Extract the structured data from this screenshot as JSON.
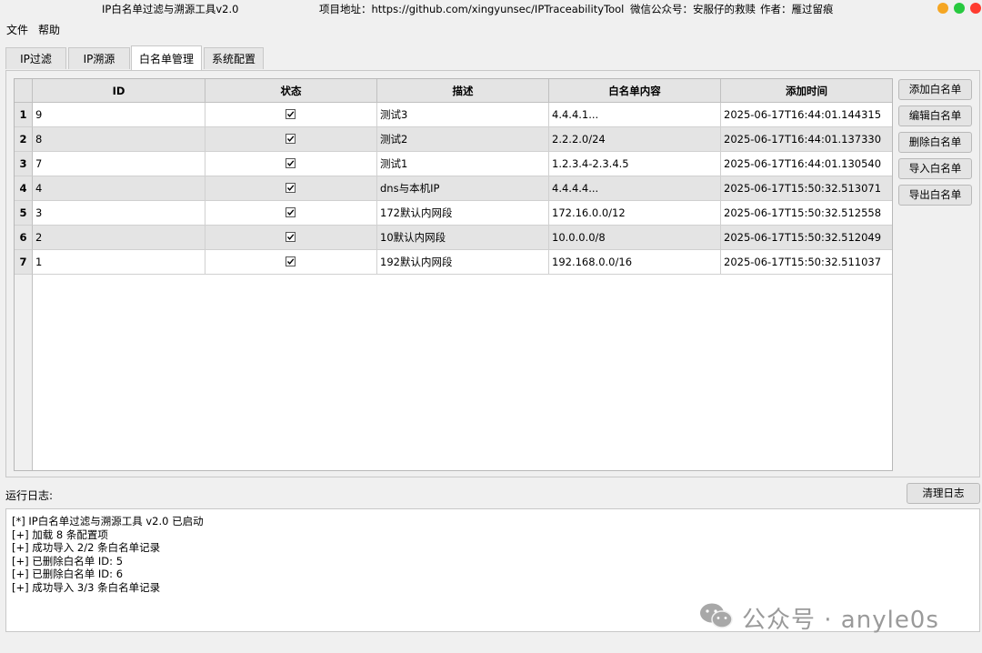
{
  "window": {
    "title": "IP白名单过滤与溯源工具v2.0",
    "project_url_label": "项目地址：https://github.com/xingyunsec/IPTraceabilityTool",
    "wechat_label": "微信公众号：安服仔的救赎",
    "author_label": "作者：雁过留痕",
    "traffic_colors": [
      "#f5a623",
      "#27c93f",
      "#ff3b30"
    ]
  },
  "menu": [
    "文件",
    "帮助"
  ],
  "tabs": [
    "IP过滤",
    "IP溯源",
    "白名单管理",
    "系统配置"
  ],
  "active_tab": "白名单管理",
  "table": {
    "headers": [
      "ID",
      "状态",
      "描述",
      "白名单内容",
      "添加时间"
    ],
    "rows": [
      {
        "num": "1",
        "id": "9",
        "checked": true,
        "desc": "测试3",
        "content": "4.4.4.1...",
        "time": "2025-06-17T16:44:01.144315"
      },
      {
        "num": "2",
        "id": "8",
        "checked": true,
        "desc": "测试2",
        "content": "2.2.2.0/24",
        "time": "2025-06-17T16:44:01.137330"
      },
      {
        "num": "3",
        "id": "7",
        "checked": true,
        "desc": "测试1",
        "content": "1.2.3.4-2.3.4.5",
        "time": "2025-06-17T16:44:01.130540"
      },
      {
        "num": "4",
        "id": "4",
        "checked": true,
        "desc": "dns与本机IP",
        "content": "4.4.4.4...",
        "time": "2025-06-17T15:50:32.513071"
      },
      {
        "num": "5",
        "id": "3",
        "checked": true,
        "desc": "172默认内网段",
        "content": "172.16.0.0/12",
        "time": "2025-06-17T15:50:32.512558"
      },
      {
        "num": "6",
        "id": "2",
        "checked": true,
        "desc": "10默认内网段",
        "content": "10.0.0.0/8",
        "time": "2025-06-17T15:50:32.512049"
      },
      {
        "num": "7",
        "id": "1",
        "checked": true,
        "desc": "192默认内网段",
        "content": "192.168.0.0/16",
        "time": "2025-06-17T15:50:32.511037"
      }
    ]
  },
  "buttons": {
    "add": "添加白名单",
    "edit": "编辑白名单",
    "delete": "删除白名单",
    "import": "导入白名单",
    "export": "导出白名单",
    "clear_log": "清理日志"
  },
  "log": {
    "label": "运行日志:",
    "lines": [
      "[*] IP白名单过滤与溯源工具 v2.0 已启动",
      "[+] 加载 8 条配置项",
      "[+] 成功导入 2/2 条白名单记录",
      "[+] 已删除白名单 ID: 5",
      "[+] 已删除白名单 ID: 6",
      "[+] 成功导入 3/3 条白名单记录"
    ]
  },
  "watermark": "公众号 · anyle0s"
}
